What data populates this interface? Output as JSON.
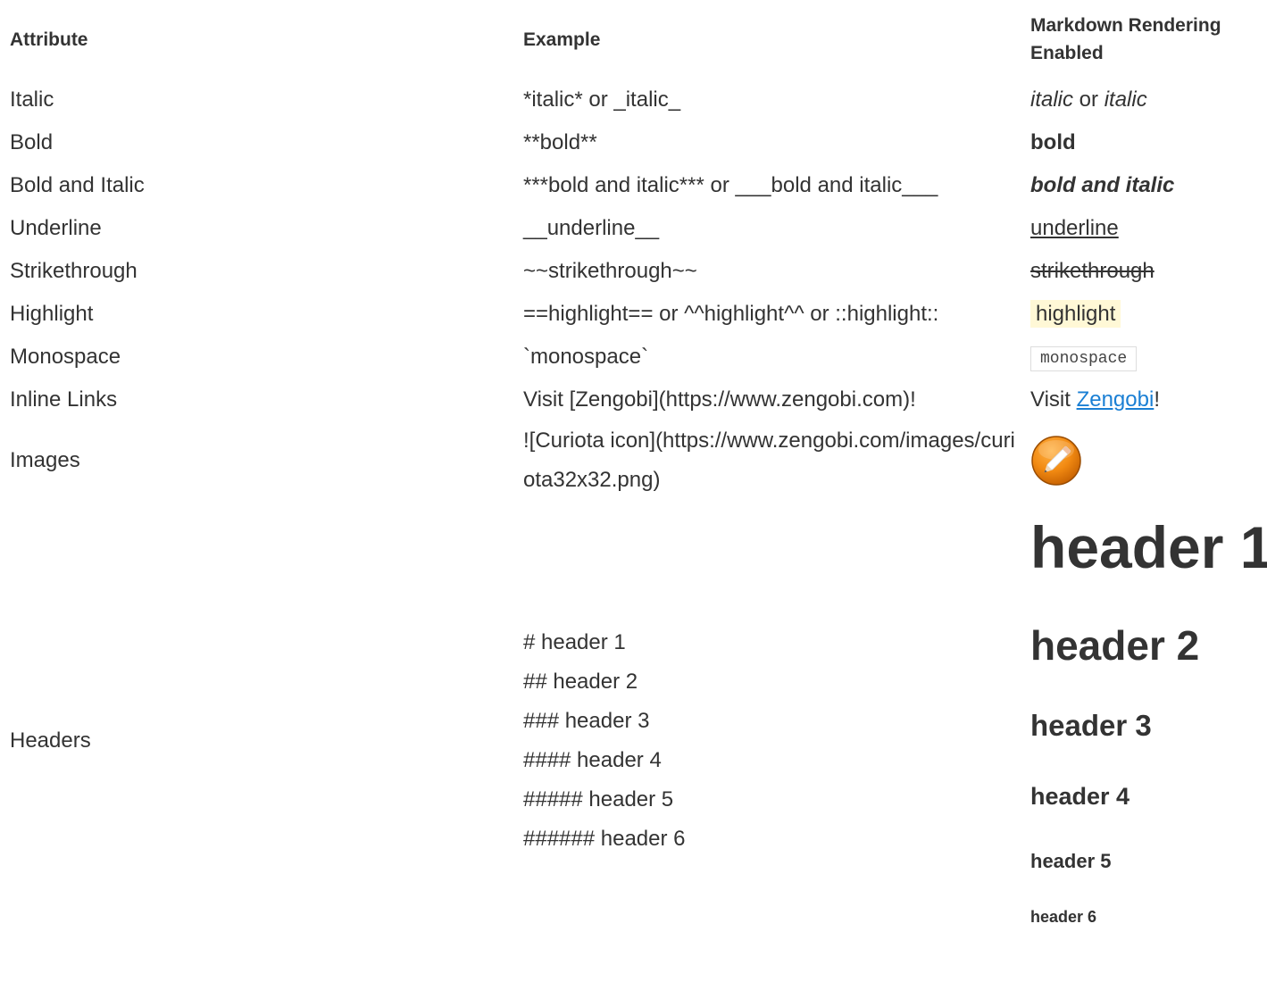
{
  "headers": {
    "attribute": "Attribute",
    "example": "Example",
    "rendered": "Markdown Rendering Enabled"
  },
  "rows": {
    "italic": {
      "attribute": "Italic",
      "example": "*italic* or _italic_",
      "rendered_a": "italic",
      "rendered_sep": " or ",
      "rendered_b": "italic"
    },
    "bold": {
      "attribute": "Bold",
      "example": "**bold**",
      "rendered": "bold"
    },
    "bold_italic": {
      "attribute": "Bold and Italic",
      "example": "***bold and italic*** or ___bold and italic___",
      "rendered": "bold and italic"
    },
    "underline": {
      "attribute": "Underline",
      "example": "__underline__",
      "rendered": "underline"
    },
    "strikethrough": {
      "attribute": "Strikethrough",
      "example": "~~strikethrough~~",
      "rendered": "strikethrough"
    },
    "highlight": {
      "attribute": "Highlight",
      "example": "==highlight== or ^^highlight^^ or ::highlight::",
      "rendered": "highlight",
      "bg_color": "#fff8d6"
    },
    "monospace": {
      "attribute": "Monospace",
      "example": "`monospace`",
      "rendered": "monospace"
    },
    "links": {
      "attribute": "Inline Links",
      "example": "Visit [Zengobi](https://www.zengobi.com)!",
      "rendered_prefix": "Visit ",
      "rendered_link": "Zengobi",
      "rendered_suffix": "!",
      "link_color": "#1a7fd4"
    },
    "images": {
      "attribute": "Images",
      "example": "![Curiota icon](https://www.zengobi.com/images/curiota32x32.png)",
      "icon": "pencil-app-icon"
    },
    "headers": {
      "attribute": "Headers",
      "examples": [
        "# header 1",
        "## header 2",
        "### header 3",
        "#### header 4",
        "##### header 5",
        "###### header 6"
      ],
      "rendered": [
        "header 1",
        "header 2",
        "header 3",
        "header 4",
        "header 5",
        "header 6"
      ]
    }
  }
}
